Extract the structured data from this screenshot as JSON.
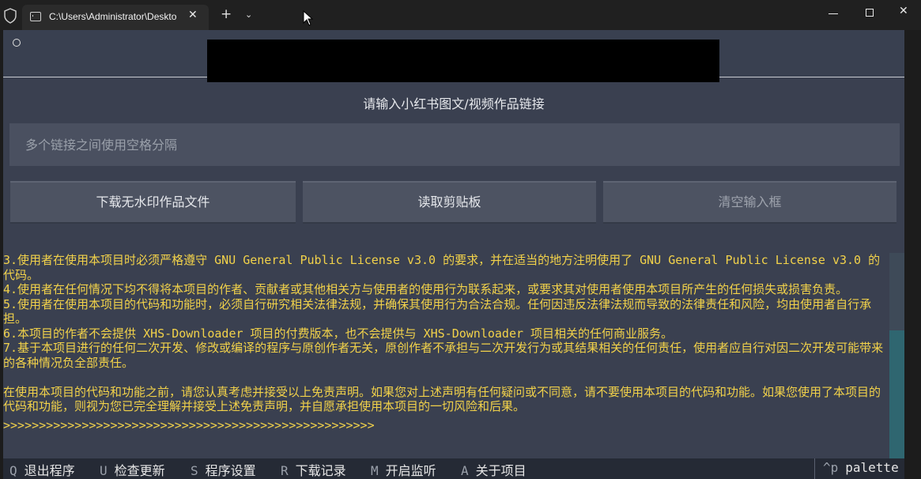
{
  "window": {
    "tab_title": "C:\\Users\\Administrator\\Deskto",
    "tab_close": "✕",
    "new_tab": "+",
    "tab_dropdown": "⌄",
    "close_window": "✕"
  },
  "app": {
    "prompt": "请输入小红书图文/视频作品链接",
    "input_placeholder": "多个链接之间使用空格分隔",
    "buttons": {
      "download": "下载无水印作品文件",
      "paste": "读取剪贴板",
      "clear": "清空输入框"
    }
  },
  "log": {
    "lines": [
      "3.使用者在使用本项目时必须严格遵守 GNU General Public License v3.0 的要求，并在适当的地方注明使用了 GNU General Public License v3.0 的代码。",
      "4.使用者在任何情况下均不得将本项目的作者、贡献者或其他相关方与使用者的使用行为联系起来，或要求其对使用者使用本项目所产生的任何损失或损害负责。",
      "5.使用者在使用本项目的代码和功能时，必须自行研究相关法律法规，并确保其使用行为合法合规。任何因违反法律法规而导致的法律责任和风险，均由使用者自行承担。",
      "6.本项目的作者不会提供 XHS-Downloader 项目的付费版本，也不会提供与 XHS-Downloader 项目相关的任何商业服务。",
      "7.基于本项目进行的任何二次开发、修改或编译的程序与原创作者无关，原创作者不承担与二次开发行为或其结果相关的任何责任，使用者应自行对因二次开发可能带来的各种情况负全部责任。",
      "在使用本项目的代码和功能之前，请您认真考虑并接受以上免责声明。如果您对上述声明有任何疑问或不同意，请不要使用本项目的代码和功能。如果您使用了本项目的代码和功能，则视为您已完全理解并接受上述免责声明，并自愿承担使用本项目的一切风险和后果。"
    ],
    "rule": ">>>>>>>>>>>>>>>>>>>>>>>>>>>>>>>>>>>>>>>>>>>>>>>>>>>>",
    "text_color": "#f2d24a"
  },
  "footer": {
    "keys": [
      {
        "key": "Q",
        "label": "退出程序"
      },
      {
        "key": "U",
        "label": "检查更新"
      },
      {
        "key": "S",
        "label": "程序设置"
      },
      {
        "key": "R",
        "label": "下载记录"
      },
      {
        "key": "M",
        "label": "开启监听"
      },
      {
        "key": "A",
        "label": "关于项目"
      }
    ],
    "palette_key": "^p",
    "palette_label": "palette"
  }
}
